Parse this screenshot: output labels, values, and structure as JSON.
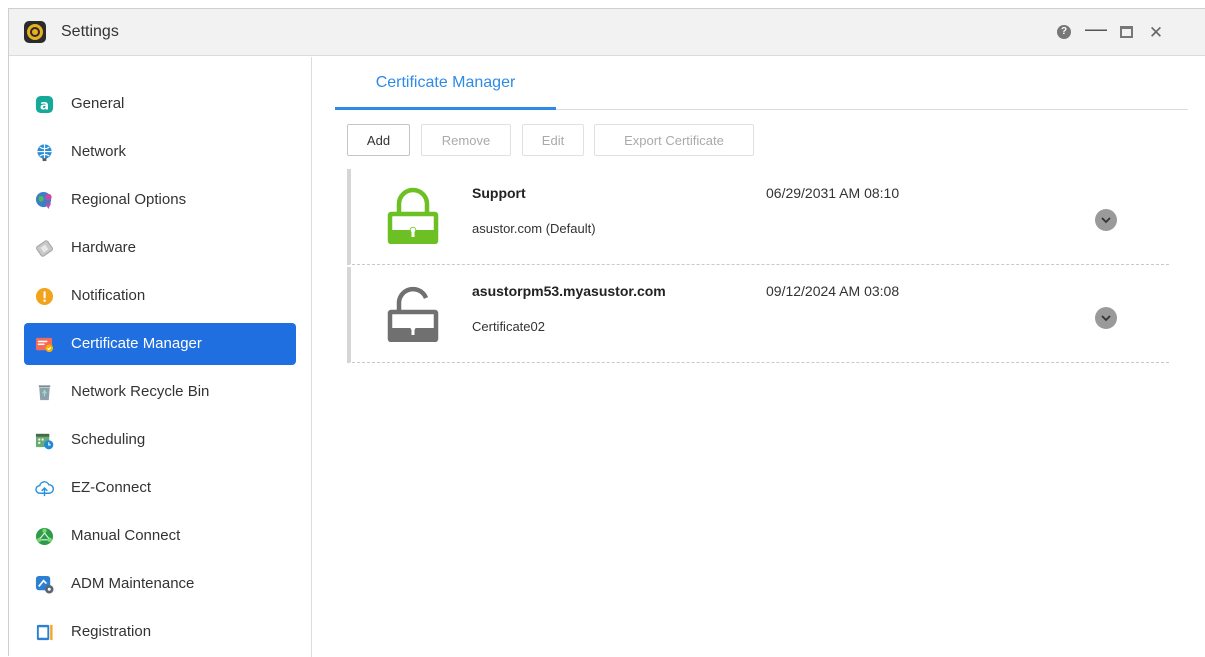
{
  "window": {
    "title": "Settings",
    "icons": {
      "app": "settings-gear-icon",
      "help": "help-icon",
      "minimize": "minimize-icon",
      "maximize": "maximize-icon",
      "close": "close-icon"
    },
    "controls": {
      "help": "?",
      "minimize": "—",
      "close": "✕"
    }
  },
  "sidebar": {
    "active_color": "#1f6fe0",
    "items": [
      {
        "label": "General",
        "icon": "general-icon",
        "active": false
      },
      {
        "label": "Network",
        "icon": "globe-icon",
        "active": false
      },
      {
        "label": "Regional Options",
        "icon": "regional-options-icon",
        "active": false
      },
      {
        "label": "Hardware",
        "icon": "hardware-icon",
        "active": false
      },
      {
        "label": "Notification",
        "icon": "notification-icon",
        "active": false
      },
      {
        "label": "Certificate Manager",
        "icon": "certificate-icon",
        "active": true
      },
      {
        "label": "Network Recycle Bin",
        "icon": "recycle-bin-icon",
        "active": false
      },
      {
        "label": "Scheduling",
        "icon": "calendar-clock-icon",
        "active": false
      },
      {
        "label": "EZ-Connect",
        "icon": "cloud-upload-icon",
        "active": false
      },
      {
        "label": "Manual Connect",
        "icon": "manual-connect-icon",
        "active": false
      },
      {
        "label": "ADM Maintenance",
        "icon": "maintenance-icon",
        "active": false
      },
      {
        "label": "Registration",
        "icon": "registration-icon",
        "active": false
      }
    ]
  },
  "main": {
    "tab": "Certificate Manager",
    "toolbar": {
      "add": "Add",
      "remove": "Remove",
      "edit": "Edit",
      "export": "Export Certificate"
    },
    "certificates": [
      {
        "name": "Support",
        "description": "asustor.com (Default)",
        "expires": "06/29/2031 AM 08:10",
        "lock_icon": "locked-padlock-icon",
        "color": "#6cc024"
      },
      {
        "name": "asustorpm53.myasustor.com",
        "description": "Certificate02",
        "expires": "09/12/2024 AM 03:08",
        "lock_icon": "unlocked-padlock-icon",
        "color": "#707070"
      }
    ],
    "accent_color": "#2d8be6"
  }
}
